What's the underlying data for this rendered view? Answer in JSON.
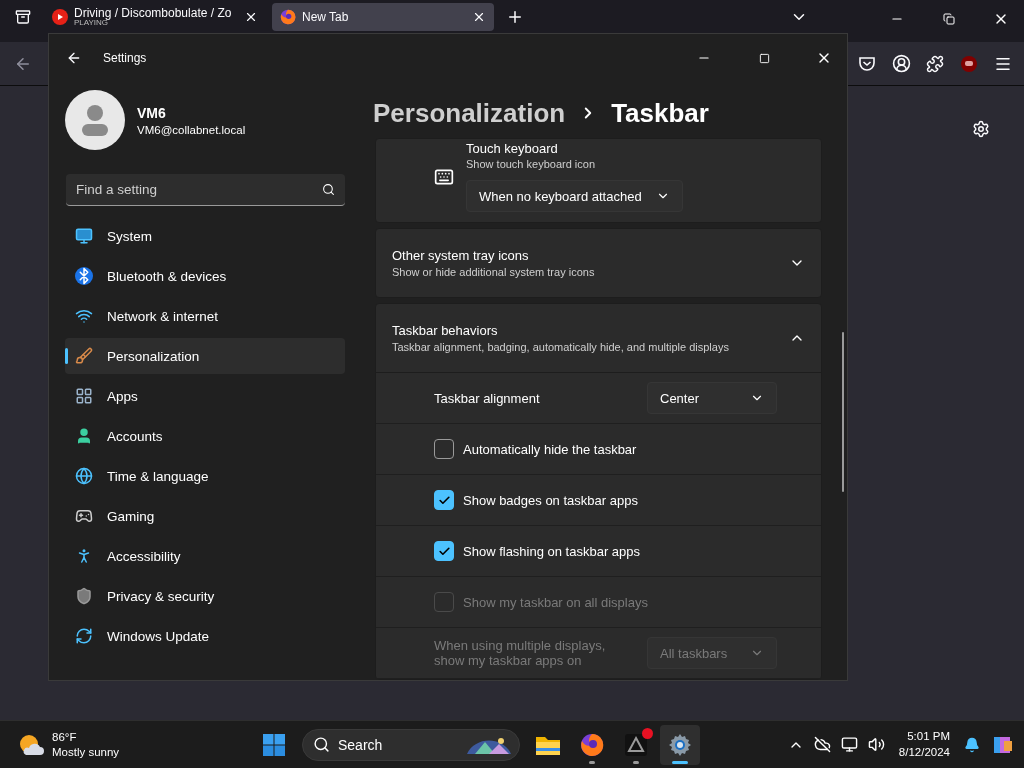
{
  "browser": {
    "tabs": [
      {
        "title": "Driving / Discombobulate / Zo",
        "status": "PLAYING",
        "kind": "media",
        "selected": false
      },
      {
        "title": "New Tab",
        "kind": "browser",
        "selected": true
      }
    ]
  },
  "settings": {
    "title": "Settings",
    "user": {
      "name": "VM6",
      "email": "VM6@collabnet.local"
    },
    "search": {
      "placeholder": "Find a setting"
    },
    "nav": [
      {
        "label": "System",
        "selected": false
      },
      {
        "label": "Bluetooth & devices",
        "selected": false
      },
      {
        "label": "Network & internet",
        "selected": false
      },
      {
        "label": "Personalization",
        "selected": true
      },
      {
        "label": "Apps",
        "selected": false
      },
      {
        "label": "Accounts",
        "selected": false
      },
      {
        "label": "Time & language",
        "selected": false
      },
      {
        "label": "Gaming",
        "selected": false
      },
      {
        "label": "Accessibility",
        "selected": false
      },
      {
        "label": "Privacy & security",
        "selected": false
      },
      {
        "label": "Windows Update",
        "selected": false
      }
    ],
    "breadcrumb": [
      "Personalization",
      "Taskbar"
    ],
    "sections": [
      {
        "kind": "setting",
        "title": "Touch keyboard",
        "subtitle": "Show touch keyboard icon",
        "value": "When no keyboard attached"
      },
      {
        "kind": "expander",
        "title": "Other system tray icons",
        "subtitle": "Show or hide additional system tray icons",
        "expanded": false
      },
      {
        "kind": "expander",
        "title": "Taskbar behaviors",
        "subtitle": "Taskbar alignment, badging, automatically hide, and multiple displays",
        "expanded": true,
        "items": [
          {
            "kind": "dropdown",
            "label": "Taskbar alignment",
            "value": "Center",
            "disabled": false
          },
          {
            "kind": "checkbox",
            "label": "Automatically hide the taskbar",
            "checked": false,
            "disabled": false
          },
          {
            "kind": "checkbox",
            "label": "Show badges on taskbar apps",
            "checked": true,
            "disabled": false
          },
          {
            "kind": "checkbox",
            "label": "Show flashing on taskbar apps",
            "checked": true,
            "disabled": false
          },
          {
            "kind": "checkbox",
            "label": "Show my taskbar on all displays",
            "checked": false,
            "disabled": true
          },
          {
            "kind": "dropdown",
            "label": "When using multiple displays, show my taskbar apps on",
            "value": "All taskbars",
            "disabled": true
          }
        ]
      }
    ]
  },
  "taskbar": {
    "weather": {
      "temperature": "86°F",
      "condition": "Mostly sunny"
    },
    "search": {
      "placeholder": "Search"
    },
    "apps": [
      {
        "kind": "files",
        "running": false,
        "selected": false,
        "badge": false
      },
      {
        "kind": "firefox",
        "running": true,
        "selected": false,
        "badge": false
      },
      {
        "kind": "app",
        "running": true,
        "selected": false,
        "badge": true
      },
      {
        "kind": "settings",
        "running": true,
        "selected": true,
        "badge": false
      }
    ],
    "time": "5:01 PM",
    "date": "8/12/2024"
  }
}
